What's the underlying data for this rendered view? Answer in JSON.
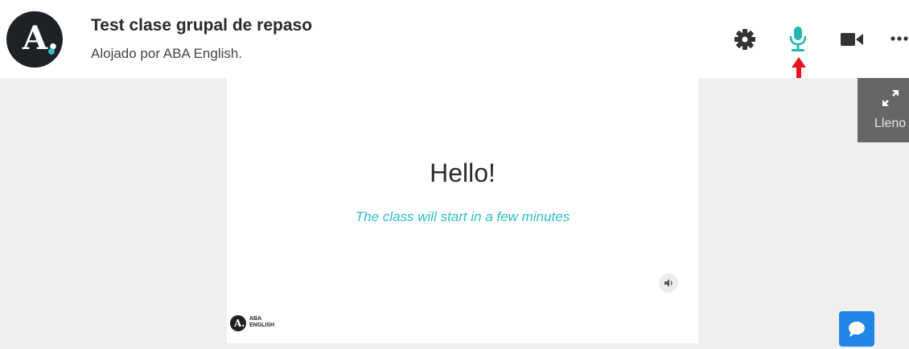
{
  "header": {
    "title": "Test clase grupal de repaso",
    "subtitle": "Alojado por ABA English.",
    "logo_letter": "A."
  },
  "toolbar": {
    "icons": [
      "gear-icon",
      "microphone-icon",
      "video-camera-icon",
      "more-icon"
    ]
  },
  "slide": {
    "heading": "Hello!",
    "subtitle": "The class will start in a few minutes",
    "brand_letter": "A.",
    "brand_line1": "ABA",
    "brand_line2": "ENGLISH"
  },
  "fullscreen": {
    "label": "Lleno"
  },
  "colors": {
    "accent": "#2fbfc6",
    "mic_active": "#22b7b0",
    "annotation_arrow": "#e8131b",
    "chat_button": "#1f86e6",
    "logo_bg": "#1e2226",
    "content_bg": "#efefef",
    "fullscreen_bg": "#666666"
  }
}
